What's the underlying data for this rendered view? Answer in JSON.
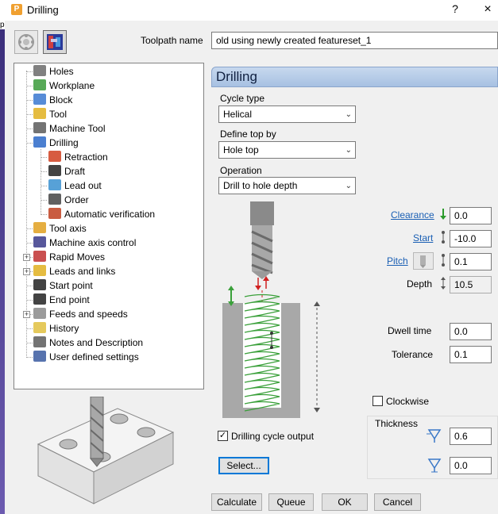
{
  "window": {
    "title": "Drilling",
    "help_symbol": "?",
    "close_symbol": "×",
    "left_edge_char": "p"
  },
  "toolbar": {
    "btn1_icon": "strategy-selector-icon",
    "btn2_icon": "toolpath-preview-icon"
  },
  "toolpath_name": {
    "label": "Toolpath name",
    "value": "old using newly created featureset_1"
  },
  "tree": {
    "items": [
      {
        "label": "Holes",
        "icon": "holes-icon",
        "color": "#6a6a6a"
      },
      {
        "label": "Workplane",
        "icon": "workplane-icon",
        "color": "#3a9a3a"
      },
      {
        "label": "Block",
        "icon": "block-icon",
        "color": "#3a78d0"
      },
      {
        "label": "Tool",
        "icon": "tool-icon",
        "color": "#e0b020"
      },
      {
        "label": "Machine Tool",
        "icon": "machine-tool-icon",
        "color": "#5a5a5a"
      },
      {
        "label": "Drilling",
        "icon": "drilling-icon",
        "color": "#2c68c8"
      },
      {
        "label": "Retraction",
        "icon": "retraction-icon",
        "color": "#d04020"
      },
      {
        "label": "Draft",
        "icon": "draft-icon",
        "color": "#222222"
      },
      {
        "label": "Lead out",
        "icon": "lead-out-icon",
        "color": "#3a90d0"
      },
      {
        "label": "Order",
        "icon": "order-icon",
        "color": "#444444"
      },
      {
        "label": "Automatic verification",
        "icon": "automatic-verification-icon",
        "color": "#c04020"
      },
      {
        "label": "Tool axis",
        "icon": "tool-axis-icon",
        "color": "#e0a020"
      },
      {
        "label": "Machine axis control",
        "icon": "machine-axis-control-icon",
        "color": "#3a3a8a"
      },
      {
        "label": "Rapid Moves",
        "icon": "rapid-moves-icon",
        "color": "#c03030"
      },
      {
        "label": "Leads and links",
        "icon": "leads-and-links-icon",
        "color": "#e0b020"
      },
      {
        "label": "Start point",
        "icon": "start-point-icon",
        "color": "#222222"
      },
      {
        "label": "End point",
        "icon": "end-point-icon",
        "color": "#222222"
      },
      {
        "label": "Feeds and speeds",
        "icon": "feeds-and-speeds-icon",
        "color": "#8a8a8a"
      },
      {
        "label": "History",
        "icon": "history-icon",
        "color": "#e0c040"
      },
      {
        "label": "Notes and Description",
        "icon": "notes-icon",
        "color": "#5a5a5a"
      },
      {
        "label": "User defined settings",
        "icon": "user-defined-settings-icon",
        "color": "#3a5aa0"
      }
    ],
    "expander_symbol": "+"
  },
  "panel": {
    "header": "Drilling",
    "cycle_type": {
      "label": "Cycle type",
      "value": "Helical"
    },
    "define_top_by": {
      "label": "Define top by",
      "value": "Hole top"
    },
    "operation": {
      "label": "Operation",
      "value": "Drill to hole depth"
    },
    "clearance": {
      "label": "Clearance",
      "value": "0.0"
    },
    "start": {
      "label": "Start",
      "value": "-10.0"
    },
    "pitch": {
      "label": "Pitch",
      "value": "0.1"
    },
    "depth": {
      "label": "Depth",
      "value": "10.5"
    },
    "dwell_time": {
      "label": "Dwell time",
      "value": "0.0"
    },
    "tolerance": {
      "label": "Tolerance",
      "value": "0.1"
    },
    "clockwise": {
      "label": "Clockwise",
      "checked": false
    },
    "thickness": {
      "label": "Thickness",
      "radial": "0.6",
      "axial": "0.0"
    },
    "drilling_cycle_output": {
      "label": "Drilling cycle output",
      "checked": true,
      "check_glyph": "✓"
    },
    "select_button": "Select..."
  },
  "buttons": {
    "calculate": "Calculate",
    "queue": "Queue",
    "ok": "OK",
    "cancel": "Cancel"
  },
  "colors": {
    "accent_link": "#1a5fb4",
    "header_bg": "#b5cbe8",
    "helix": "#3aa03a"
  }
}
